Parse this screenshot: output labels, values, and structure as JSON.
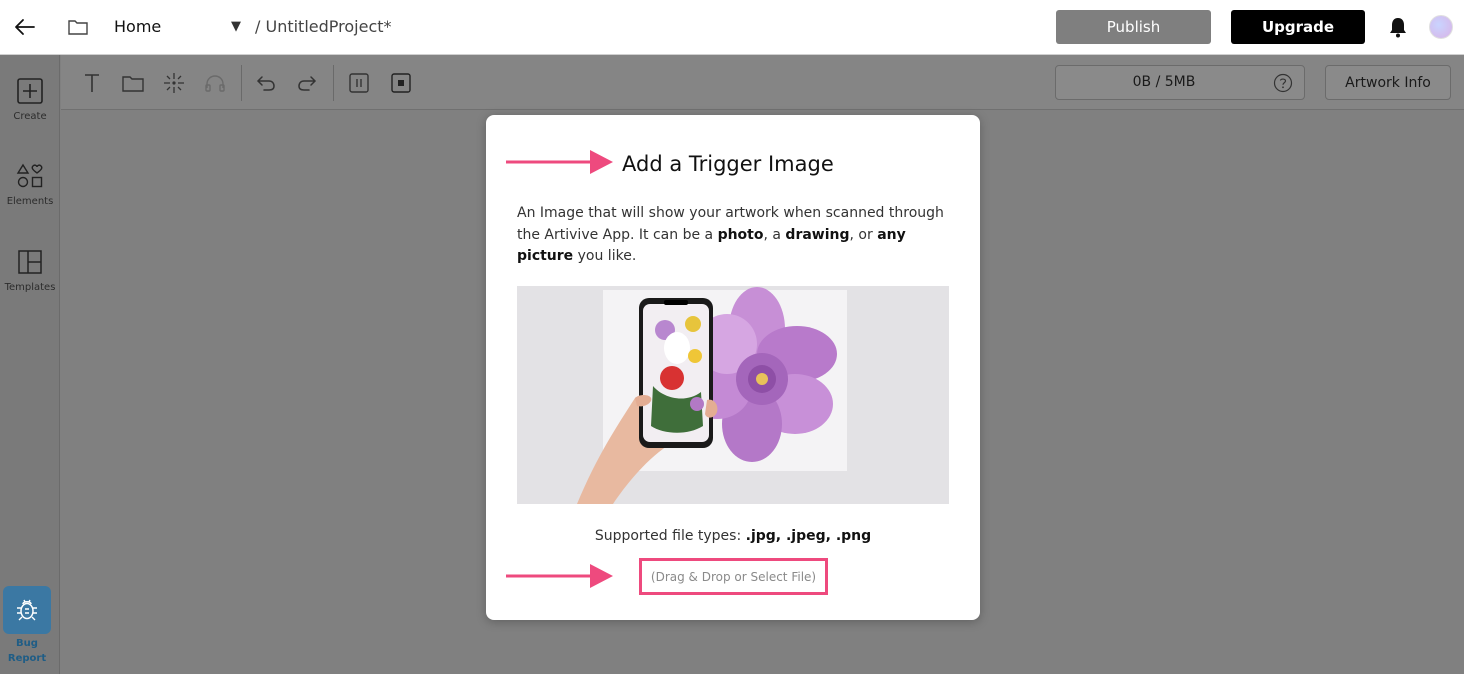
{
  "header": {
    "home_label": "Home",
    "separator": "/",
    "project_name": "UntitledProject*",
    "publish_label": "Publish",
    "upgrade_label": "Upgrade"
  },
  "sidebar": {
    "items": [
      {
        "label": "Create",
        "icon": "plus-square-icon"
      },
      {
        "label": "Elements",
        "icon": "shapes-icon"
      },
      {
        "label": "Templates",
        "icon": "layout-icon"
      }
    ],
    "bug_report_label": "Bug Report"
  },
  "toolbar": {
    "tools": [
      "text-icon",
      "folder-icon",
      "sparkle-icon",
      "headphones-icon",
      "undo-icon",
      "redo-icon",
      "pause-icon",
      "stop-icon"
    ],
    "storage_label": "0B / 5MB",
    "artwork_info_label": "Artwork Info"
  },
  "modal": {
    "title": "Add a Trigger Image",
    "description_part1": "An Image that will show your artwork when scanned through the Artivive App. It can be a ",
    "description_bold1": "photo",
    "description_part2": ", a ",
    "description_bold2": "drawing",
    "description_part3": ", or ",
    "description_bold3": "any picture",
    "description_part4": " you like.",
    "supported_label": "Supported file types: ",
    "supported_types": ".jpg, .jpeg, .png",
    "dropzone_label": "(Drag & Drop or Select File)"
  },
  "colors": {
    "accent": "#ee4a7e",
    "publish_bg": "#7f7f7f",
    "upgrade_bg": "#000000",
    "bug_button_bg": "#3b78a3"
  }
}
